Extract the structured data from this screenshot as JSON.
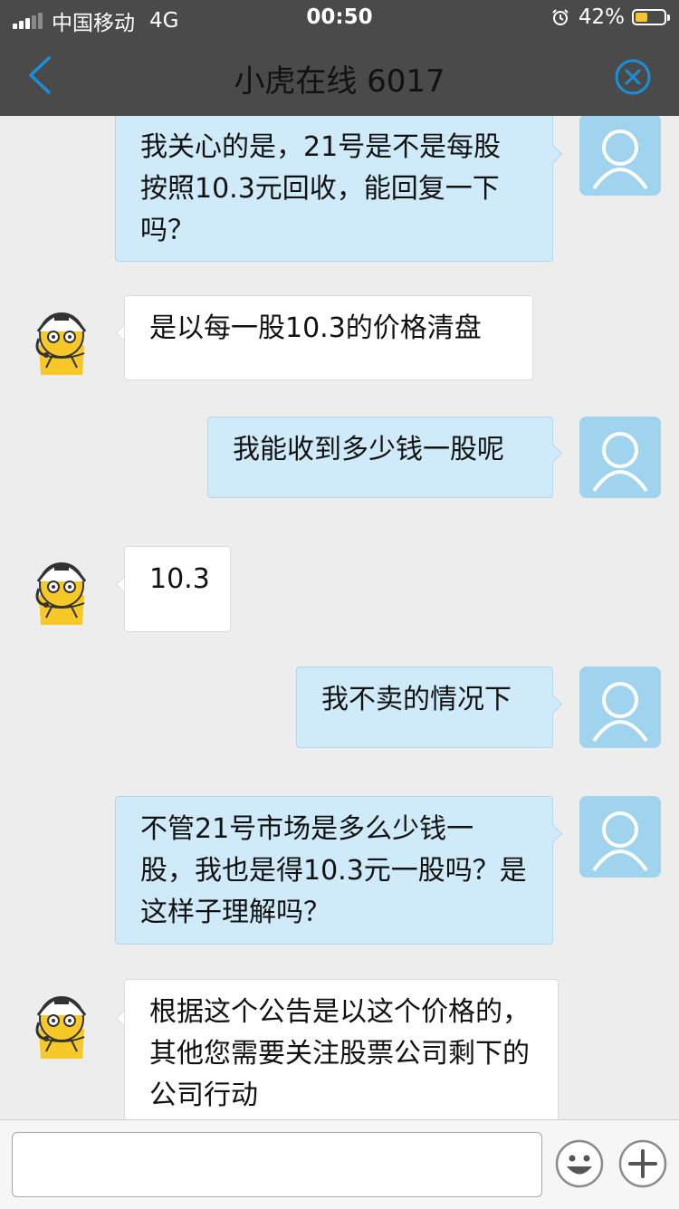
{
  "status_bar": {
    "carrier": "中国移动",
    "network": "4G",
    "time": "00:50",
    "battery": "42%",
    "battery_level": 0.42,
    "battery_color": "#f5c433"
  },
  "nav": {
    "title": "小虎在线 6017",
    "back_icon": "chevron-left-icon",
    "close_icon": "close-circle-icon",
    "accent": "#1b8fd8"
  },
  "messages": [
    {
      "side": "out",
      "text": "我关心的是，21号是不是每股按照10.3元回收，能回复一下吗？"
    },
    {
      "side": "in",
      "text": "是以每一股10.3的价格清盘"
    },
    {
      "side": "out",
      "text": "我能收到多少钱一股呢"
    },
    {
      "side": "in",
      "text": "10.3"
    },
    {
      "side": "out",
      "text": "我不卖的情况下"
    },
    {
      "side": "out",
      "text": "不管21号市场是多么少钱一股，我也是得10.3元一股吗？是这样子理解吗？"
    },
    {
      "side": "in",
      "text": "根据这个公告是以这个价格的，其他您需要关注股票公司剩下的公司行动"
    }
  ],
  "input": {
    "value": "",
    "placeholder": "",
    "emoji_icon": "emoji-icon",
    "plus_icon": "plus-icon"
  },
  "colors": {
    "outgoing_bubble": "#cfeaf9",
    "incoming_bubble": "#ffffff",
    "background": "#ededed",
    "header": "#4a4a4a"
  }
}
